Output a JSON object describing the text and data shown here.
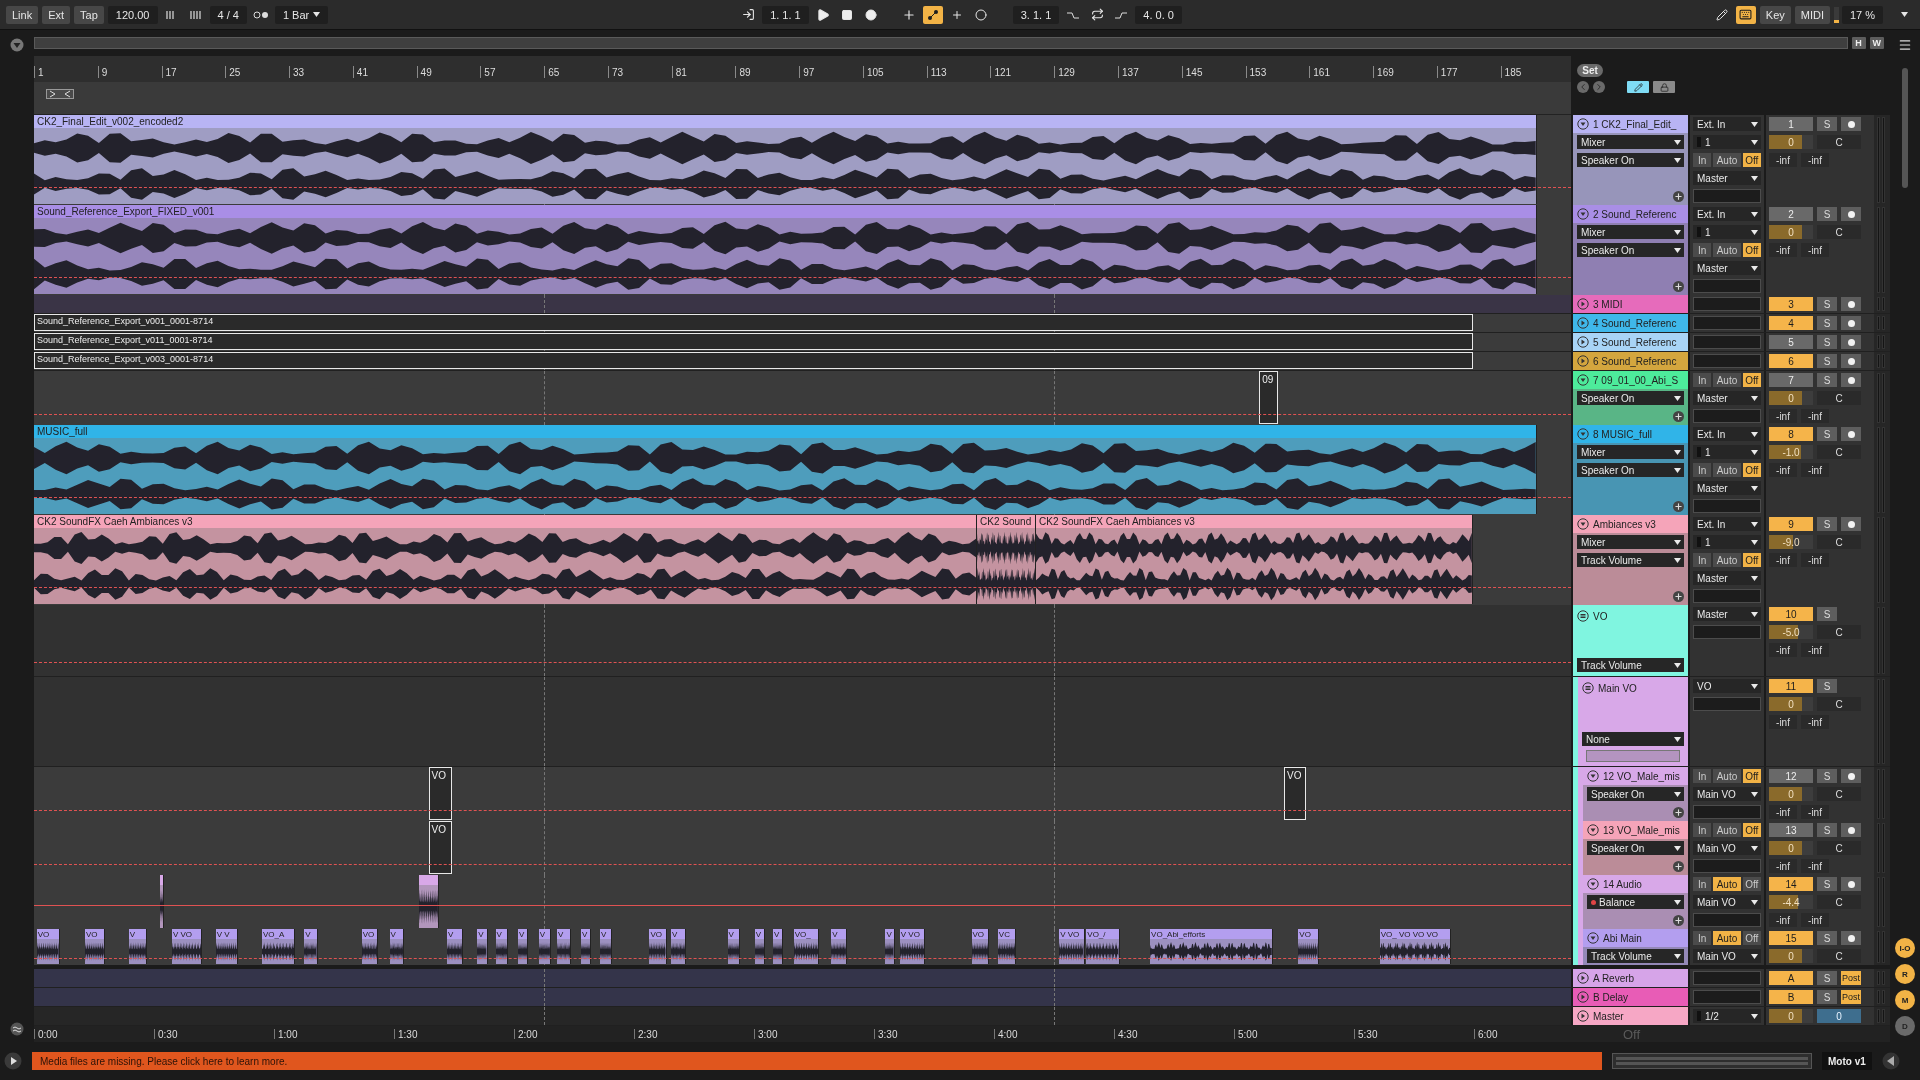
{
  "control_bar": {
    "link": "Link",
    "ext": "Ext",
    "tap": "Tap",
    "tempo": "120.00",
    "signature": "4 / 4",
    "quantization": "1 Bar",
    "position": "1. 1. 1",
    "loop_start": "3. 1. 1",
    "loop_length": "4. 0. 0",
    "automation_arm": true,
    "keyboard_mode": true,
    "key": "Key",
    "midi": "MIDI",
    "cpu": "17 %",
    "cpu_meter": {
      "level": 0.17
    }
  },
  "overview": {
    "buttons": [
      "H",
      "W"
    ]
  },
  "ruler": {
    "bars": [
      "1",
      "9",
      "17",
      "25",
      "33",
      "41",
      "49",
      "57",
      "65",
      "73",
      "81",
      "89",
      "97",
      "105",
      "113",
      "121",
      "129",
      "137",
      "145",
      "153",
      "161",
      "169",
      "177",
      "185"
    ],
    "set": "Set"
  },
  "tracks": [
    {
      "name": "1 CK2_Final_Edit_",
      "color": "#b8b4f4",
      "kind": "audio",
      "expanded": true,
      "header_controls": [
        {
          "label": "Mixer"
        },
        {
          "label": "Speaker On"
        }
      ],
      "add_device": true,
      "io": [
        {
          "kind": "dropdown",
          "value": "Ext. In"
        },
        {
          "kind": "channel",
          "value": "1"
        },
        {
          "kind": "monitor",
          "options": [
            {
              "label": "In",
              "selected": false
            },
            {
              "label": "Auto",
              "selected": false
            },
            {
              "label": "Off",
              "selected": true
            }
          ]
        },
        {
          "kind": "dropdown",
          "value": "Master"
        },
        {
          "kind": "field"
        }
      ],
      "mixer": {
        "number": "1",
        "active": false,
        "solo": "S",
        "arm": false,
        "volume": "0",
        "level": 0.75,
        "pan": "C",
        "sends": [
          "-inf",
          "-inf"
        ]
      },
      "automation": {
        "kind": "dashed"
      },
      "clips": [
        {
          "kind": "audio",
          "label": "CK2_Final_Edit_v002_encoded2"
        }
      ]
    },
    {
      "name": "2 Sound_Referenc",
      "color": "#a98ee6",
      "kind": "audio",
      "expanded": true,
      "header_controls": [
        {
          "label": "Mixer"
        },
        {
          "label": "Speaker On"
        }
      ],
      "add_device": true,
      "io": [
        {
          "kind": "dropdown",
          "value": "Ext. In"
        },
        {
          "kind": "channel",
          "value": "1"
        },
        {
          "kind": "monitor",
          "options": [
            {
              "label": "In",
              "selected": false
            },
            {
              "label": "Auto",
              "selected": false
            },
            {
              "label": "Off",
              "selected": true
            }
          ]
        },
        {
          "kind": "dropdown",
          "value": "Master"
        },
        {
          "kind": "field"
        }
      ],
      "mixer": {
        "number": "2",
        "active": false,
        "solo": "S",
        "arm": false,
        "volume": "0",
        "level": 0.75,
        "pan": "C",
        "sends": [
          "-inf",
          "-inf"
        ]
      },
      "automation": {
        "kind": "dashed"
      },
      "clips": [
        {
          "kind": "audio",
          "label": "Sound_Reference_Export_FIXED_v001"
        }
      ]
    },
    {
      "name": "3 MIDI",
      "color": "#e66bbb",
      "kind": "midi",
      "expanded": false,
      "io": [
        {
          "kind": "field"
        }
      ],
      "mixer": {
        "number": "3",
        "active": true,
        "solo": "S",
        "arm": false
      }
    },
    {
      "name": "4 Sound_Referenc",
      "color": "#3fb8ea",
      "kind": "audio",
      "expanded": false,
      "io": [
        {
          "kind": "field"
        }
      ],
      "mixer": {
        "number": "4",
        "active": true,
        "solo": "S",
        "arm": false
      },
      "clips": [
        {
          "kind": "outline",
          "label": "Sound_Reference_Export_v001_0001-8714"
        }
      ]
    },
    {
      "name": "5 Sound_Referenc",
      "color": "#a8d4f6",
      "kind": "audio",
      "expanded": false,
      "io": [
        {
          "kind": "field"
        }
      ],
      "mixer": {
        "number": "5",
        "active": false,
        "solo": "S",
        "arm": false
      },
      "clips": [
        {
          "kind": "outline",
          "label": "Sound_Reference_Export_v011_0001-8714"
        }
      ]
    },
    {
      "name": "6 Sound_Referenc",
      "color": "#d4a63e",
      "kind": "audio",
      "expanded": false,
      "io": [
        {
          "kind": "field"
        }
      ],
      "mixer": {
        "number": "6",
        "active": true,
        "solo": "S",
        "arm": false
      },
      "clips": [
        {
          "kind": "outline",
          "label": "Sound_Reference_Export_v003_0001-8714"
        }
      ]
    },
    {
      "name": "7 09_01_00_Abi_S",
      "color": "#4deb9b",
      "kind": "audio",
      "expanded": true,
      "header_controls": [
        {
          "label": "Speaker On"
        }
      ],
      "add_device": true,
      "io": [
        {
          "kind": "monitor",
          "options": [
            {
              "label": "In",
              "selected": false
            },
            {
              "label": "Auto",
              "selected": false
            },
            {
              "label": "Off",
              "selected": true
            }
          ]
        },
        {
          "kind": "dropdown",
          "value": "Master"
        },
        {
          "kind": "field"
        }
      ],
      "mixer": {
        "number": "7",
        "active": false,
        "solo": "S",
        "arm": false,
        "volume": "0",
        "level": 0.75,
        "pan": "C",
        "sends": [
          "-inf",
          "-inf"
        ]
      },
      "automation": {
        "kind": "dashed"
      },
      "clips": [
        {
          "kind": "outline",
          "label": "09"
        }
      ]
    },
    {
      "name": "8 MUSIC_full",
      "color": "#30b4e8",
      "kind": "audio",
      "expanded": true,
      "header_controls": [
        {
          "label": "Mixer"
        },
        {
          "label": "Speaker On"
        }
      ],
      "add_device": true,
      "io": [
        {
          "kind": "dropdown",
          "value": "Ext. In"
        },
        {
          "kind": "channel",
          "value": "1"
        },
        {
          "kind": "monitor",
          "options": [
            {
              "label": "In",
              "selected": false
            },
            {
              "label": "Auto",
              "selected": false
            },
            {
              "label": "Off",
              "selected": true
            }
          ]
        },
        {
          "kind": "dropdown",
          "value": "Master"
        },
        {
          "kind": "field"
        }
      ],
      "mixer": {
        "number": "8",
        "active": true,
        "solo": "S",
        "arm": false,
        "volume": "-1.0",
        "level": 0.72,
        "pan": "C",
        "sends": [
          "-inf",
          "-inf"
        ]
      },
      "automation": {
        "kind": "dashed"
      },
      "clips": [
        {
          "kind": "audio",
          "label": "MUSIC_full"
        }
      ]
    },
    {
      "name": "Ambiances v3",
      "color": "#f5a4b9",
      "kind": "audio",
      "expanded": true,
      "header_controls": [
        {
          "label": "Mixer"
        },
        {
          "label": "Track Volume"
        }
      ],
      "add_device": true,
      "io": [
        {
          "kind": "dropdown",
          "value": "Ext. In"
        },
        {
          "kind": "channel",
          "value": "1"
        },
        {
          "kind": "monitor",
          "options": [
            {
              "label": "In",
              "selected": false
            },
            {
              "label": "Auto",
              "selected": false
            },
            {
              "label": "Off",
              "selected": true
            }
          ]
        },
        {
          "kind": "dropdown",
          "value": "Master"
        },
        {
          "kind": "field"
        }
      ],
      "mixer": {
        "number": "9",
        "active": true,
        "solo": "S",
        "arm": false,
        "volume": "-9.0",
        "level": 0.55,
        "pan": "C",
        "sends": [
          "-inf",
          "-inf"
        ]
      },
      "automation": {
        "kind": "dashed"
      },
      "clips": [
        {
          "kind": "audio",
          "label": "CK2 SoundFX Caeh Ambiances v3"
        },
        {
          "kind": "audio",
          "label": "CK2 Sound"
        },
        {
          "kind": "audio",
          "label": "CK2 SoundFX Caeh Ambiances v3"
        }
      ]
    },
    {
      "name": "VO",
      "color": "#80f5e0",
      "kind": "group",
      "expanded": true,
      "header_controls": [
        {
          "label": "Track Volume"
        }
      ],
      "io": [
        {
          "kind": "dropdown",
          "value": "Master"
        },
        {
          "kind": "field"
        }
      ],
      "mixer": {
        "number": "10",
        "active": true,
        "solo": "S",
        "volume": "-5.0",
        "level": 0.65,
        "pan": "C",
        "sends": [
          "-inf",
          "-inf"
        ]
      },
      "automation": {
        "kind": "dashed"
      },
      "children": [
        {
          "name": "Main VO",
          "color": "#d8a8e8",
          "kind": "group",
          "expanded": true,
          "header_controls": [
            {
              "label": "None"
            }
          ],
          "header_field": true,
          "io": [
            {
              "kind": "dropdown",
              "value": "VO"
            },
            {
              "kind": "field"
            }
          ],
          "mixer": {
            "number": "11",
            "active": true,
            "solo": "S",
            "volume": "0",
            "level": 0.75,
            "pan": "C",
            "sends": [
              "-inf",
              "-inf"
            ]
          },
          "children": [
            {
              "name": "12 VO_Male_mis",
              "color": "#d8a8e8",
              "kind": "audio",
              "expanded": true,
              "header_controls": [
                {
                  "label": "Speaker On"
                }
              ],
              "add_device": true,
              "io": [
                {
                  "kind": "monitor",
                  "options": [
                    {
                      "label": "In",
                      "selected": false
                    },
                    {
                      "label": "Auto",
                      "selected": false
                    },
                    {
                      "label": "Off",
                      "selected": true
                    }
                  ]
                },
                {
                  "kind": "dropdown",
                  "value": "Main VO"
                },
                {
                  "kind": "field"
                }
              ],
              "mixer": {
                "number": "12",
                "active": false,
                "solo": "S",
                "arm": false,
                "volume": "0",
                "level": 0.75,
                "pan": "C",
                "sends": [
                  "-inf",
                  "-inf"
                ]
              },
              "automation": {
                "kind": "dashed"
              },
              "clips": [
                {
                  "kind": "outline",
                  "label": "VO"
                },
                {
                  "kind": "outline",
                  "label": "VO"
                }
              ]
            },
            {
              "name": "13 VO_Male_mis",
              "color": "#f5a4b9",
              "kind": "audio",
              "expanded": true,
              "header_controls": [
                {
                  "label": "Speaker On"
                }
              ],
              "add_device": true,
              "io": [
                {
                  "kind": "monitor",
                  "options": [
                    {
                      "label": "In",
                      "selected": false
                    },
                    {
                      "label": "Auto",
                      "selected": false
                    },
                    {
                      "label": "Off",
                      "selected": true
                    }
                  ]
                },
                {
                  "kind": "dropdown",
                  "value": "Main VO"
                },
                {
                  "kind": "field"
                }
              ],
              "mixer": {
                "number": "13",
                "active": false,
                "solo": "S",
                "arm": false,
                "volume": "0",
                "level": 0.75,
                "pan": "C",
                "sends": [
                  "-inf",
                  "-inf"
                ]
              },
              "automation": {
                "kind": "dashed"
              },
              "clips": [
                {
                  "kind": "outline",
                  "label": "VO"
                }
              ]
            },
            {
              "name": "14 Audio",
              "color": "#d8a8e8",
              "kind": "audio",
              "expanded": true,
              "header_controls": [
                {
                  "label": "Balance",
                  "automated": true
                }
              ],
              "add_device": true,
              "io": [
                {
                  "kind": "monitor",
                  "options": [
                    {
                      "label": "In",
                      "selected": false
                    },
                    {
                      "label": "Auto",
                      "selected": true
                    },
                    {
                      "label": "Off",
                      "selected": false
                    }
                  ]
                },
                {
                  "kind": "dropdown",
                  "value": "Main VO"
                },
                {
                  "kind": "field"
                }
              ],
              "mixer": {
                "number": "14",
                "active": true,
                "solo": "S",
                "arm": false,
                "volume": "-4.4",
                "level": 0.66,
                "pan": "C",
                "sends": [
                  "-inf",
                  "-inf"
                ]
              },
              "automation": {
                "kind": "solid"
              },
              "clips": [
                {
                  "kind": "audio"
                },
                {
                  "kind": "audio"
                }
              ]
            },
            {
              "name": "Abi Main",
              "color": "#b39eef",
              "kind": "audio",
              "expanded": true,
              "header_controls": [
                {
                  "label": "Track Volume"
                }
              ],
              "io": [
                {
                  "kind": "monitor",
                  "options": [
                    {
                      "label": "In",
                      "selected": false
                    },
                    {
                      "label": "Auto",
                      "selected": true
                    },
                    {
                      "label": "Off",
                      "selected": false
                    }
                  ]
                },
                {
                  "kind": "dropdown",
                  "value": "Main VO"
                }
              ],
              "mixer": {
                "number": "15",
                "active": true,
                "solo": "S",
                "arm": false,
                "volume": "0",
                "level": 0.75,
                "pan": "C"
              },
              "automation": {
                "kind": "dashed"
              },
              "clips": [
                {
                  "kind": "audio",
                  "label": "VO"
                },
                {
                  "kind": "audio",
                  "label": "VO"
                },
                {
                  "kind": "audio",
                  "label": "V"
                },
                {
                  "kind": "audio",
                  "label": "V VO"
                },
                {
                  "kind": "audio",
                  "label": "V V"
                },
                {
                  "kind": "audio",
                  "label": "VO_A"
                },
                {
                  "kind": "audio",
                  "label": "V"
                },
                {
                  "kind": "audio",
                  "label": "VO"
                },
                {
                  "kind": "audio",
                  "label": "V"
                },
                {
                  "kind": "audio",
                  "label": "V"
                },
                {
                  "kind": "audio",
                  "label": "V"
                },
                {
                  "kind": "audio",
                  "label": "V"
                },
                {
                  "kind": "audio",
                  "label": "V"
                },
                {
                  "kind": "audio",
                  "label": "V"
                },
                {
                  "kind": "audio",
                  "label": "V"
                },
                {
                  "kind": "audio",
                  "label": "V"
                },
                {
                  "kind": "audio",
                  "label": "V"
                },
                {
                  "kind": "audio",
                  "label": "VO"
                },
                {
                  "kind": "audio",
                  "label": "V"
                },
                {
                  "kind": "audio",
                  "label": "V"
                },
                {
                  "kind": "audio",
                  "label": "V"
                },
                {
                  "kind": "audio",
                  "label": "V"
                },
                {
                  "kind": "audio",
                  "label": "VO_"
                },
                {
                  "kind": "audio",
                  "label": "V"
                },
                {
                  "kind": "audio",
                  "label": "V"
                },
                {
                  "kind": "audio",
                  "label": "V VO"
                },
                {
                  "kind": "audio",
                  "label": "VO"
                },
                {
                  "kind": "audio",
                  "label": "VC"
                },
                {
                  "kind": "audio",
                  "label": "V VO"
                },
                {
                  "kind": "audio",
                  "label": "VO_/"
                },
                {
                  "kind": "audio",
                  "label": "VO_Abi_efforts"
                },
                {
                  "kind": "audio",
                  "label": "VO"
                },
                {
                  "kind": "audio",
                  "label": "VO_ VO VO VO"
                }
              ]
            }
          ]
        }
      ]
    }
  ],
  "returns": [
    {
      "name": "A Reverb",
      "color": "#d6a4e8",
      "kind": "return",
      "io": [
        {
          "kind": "field"
        }
      ],
      "mixer": {
        "number": "A",
        "active": true,
        "solo": "S",
        "post": "Post"
      }
    },
    {
      "name": "B Delay",
      "color": "#e85cb6",
      "kind": "return",
      "io": [
        {
          "kind": "field"
        }
      ],
      "mixer": {
        "number": "B",
        "active": true,
        "solo": "S",
        "post": "Post"
      }
    }
  ],
  "master": {
    "name": "Master",
    "color": "#f6a7c5",
    "kind": "master",
    "io": [
      {
        "kind": "channel",
        "value": "1/2"
      }
    ],
    "mixer": {
      "volume": "0",
      "level": 0.75,
      "cue": "0"
    }
  },
  "time_ruler": {
    "labels": [
      "0:00",
      "0:30",
      "1:00",
      "1:30",
      "2:00",
      "2:30",
      "3:00",
      "3:30",
      "4:00",
      "4:30",
      "5:00",
      "5:30",
      "6:00"
    ],
    "automation_mode": "Off"
  },
  "view_toggles": [
    {
      "label": "I-O",
      "selected": true
    },
    {
      "label": "R",
      "selected": true
    },
    {
      "label": "M",
      "selected": true
    },
    {
      "label": "D",
      "selected": false
    }
  ],
  "status_bar": {
    "message": "Media files are missing. Please click here to learn more.",
    "device": "Moto v1"
  }
}
